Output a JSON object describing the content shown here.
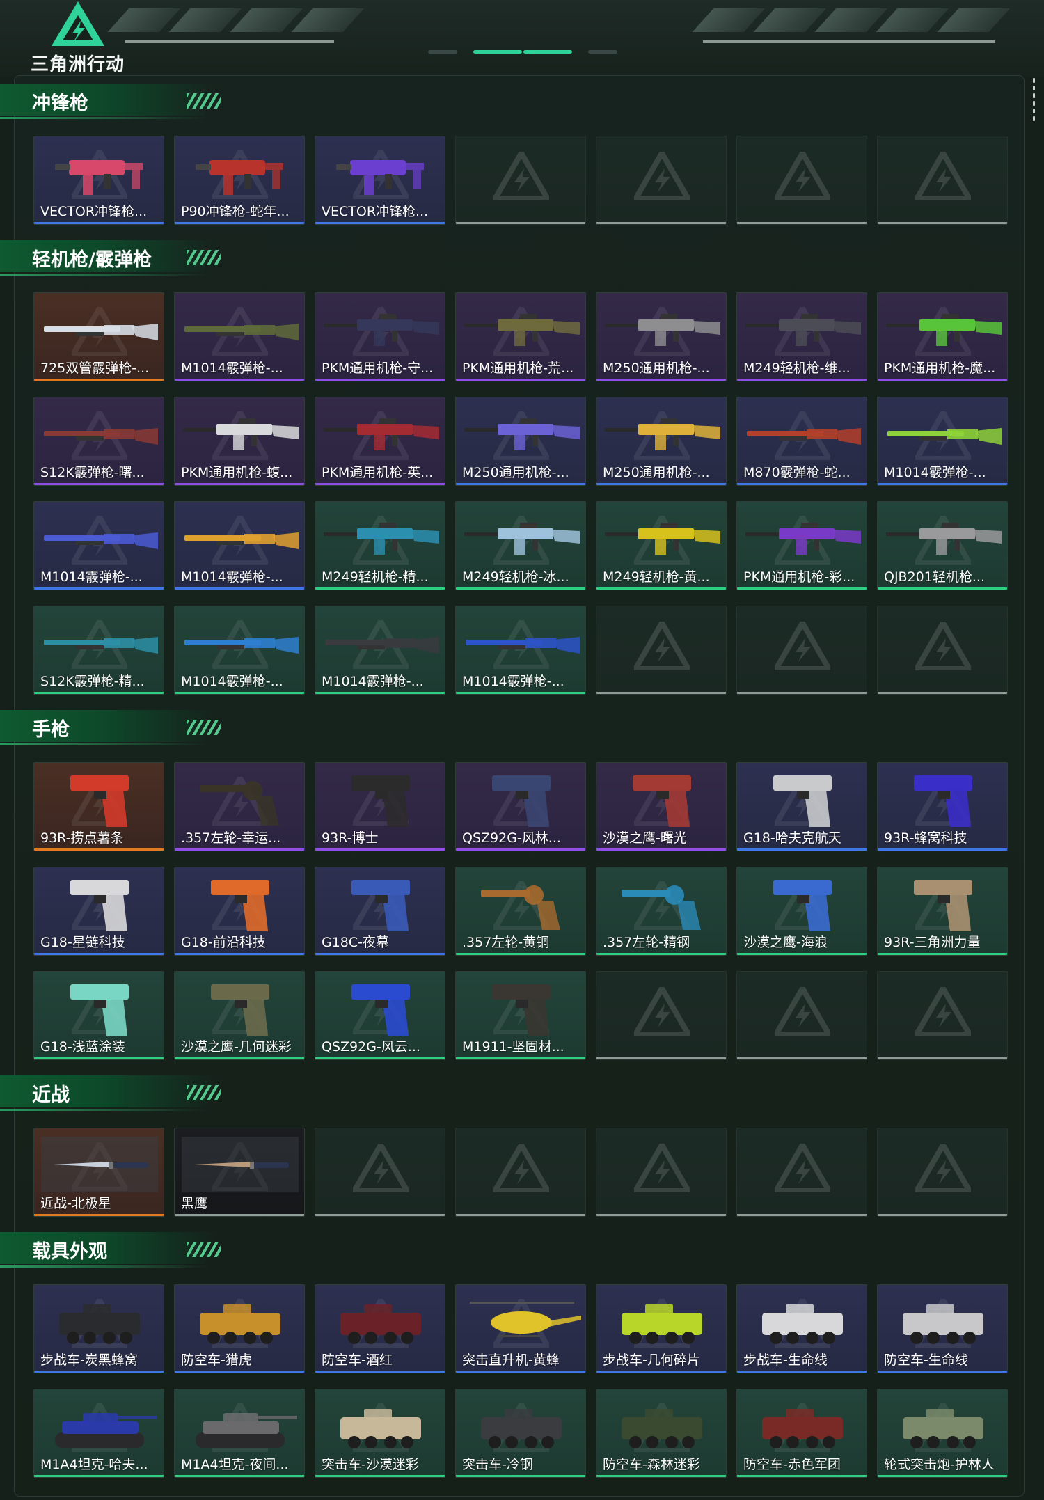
{
  "header": {
    "logo_text": "三角洲行动",
    "accent": "#2fd39a"
  },
  "sections": [
    {
      "title": "冲锋枪",
      "rows": [
        [
          {
            "label": "VECTOR冲锋枪...",
            "rarity": "blue",
            "icon": "smg-icon",
            "tint": "#d8486a"
          },
          {
            "label": "P90冲锋枪-蛇年...",
            "rarity": "blue",
            "icon": "smg-icon",
            "tint": "#b8332c"
          },
          {
            "label": "VECTOR冲锋枪...",
            "rarity": "blue",
            "icon": "smg-icon",
            "tint": "#6b3fd0"
          },
          null,
          null,
          null,
          null
        ]
      ]
    },
    {
      "title": "轻机枪/霰弹枪",
      "rows": [
        [
          {
            "label": "725双管霰弹枪-...",
            "rarity": "orange",
            "icon": "shotgun-icon",
            "tint": "#d8dde6"
          },
          {
            "label": "M1014霰弹枪-...",
            "rarity": "purple",
            "icon": "shotgun-icon",
            "tint": "#5e6a3a"
          },
          {
            "label": "PKM通用机枪-守...",
            "rarity": "purple",
            "icon": "machine-gun-icon",
            "tint": "#35385a"
          },
          {
            "label": "PKM通用机枪-荒...",
            "rarity": "purple",
            "icon": "machine-gun-icon",
            "tint": "#6f6a3e"
          },
          {
            "label": "M250通用机枪-...",
            "rarity": "purple",
            "icon": "machine-gun-icon",
            "tint": "#8e8e90"
          },
          {
            "label": "M249轻机枪-维...",
            "rarity": "purple",
            "icon": "machine-gun-icon",
            "tint": "#4b4c55"
          },
          {
            "label": "PKM通用机枪-魔...",
            "rarity": "purple",
            "icon": "machine-gun-icon",
            "tint": "#58c43a"
          }
        ],
        [
          {
            "label": "S12K霰弹枪-曙...",
            "rarity": "purple",
            "icon": "shotgun-icon",
            "tint": "#8a3a34"
          },
          {
            "label": "PKM通用机枪-蝮...",
            "rarity": "purple",
            "icon": "machine-gun-icon",
            "tint": "#d9dadc"
          },
          {
            "label": "PKM通用机枪-英...",
            "rarity": "purple",
            "icon": "machine-gun-icon",
            "tint": "#a52b32"
          },
          {
            "label": "M250通用机枪-...",
            "rarity": "blue",
            "icon": "machine-gun-icon",
            "tint": "#6b62d6"
          },
          {
            "label": "M250通用机枪-...",
            "rarity": "blue",
            "icon": "machine-gun-icon",
            "tint": "#e0b13a"
          },
          {
            "label": "M870霰弹枪-蛇...",
            "rarity": "blue",
            "icon": "shotgun-icon",
            "tint": "#b2402a"
          },
          {
            "label": "M1014霰弹枪-...",
            "rarity": "blue",
            "icon": "shotgun-icon",
            "tint": "#8ed13a"
          }
        ],
        [
          {
            "label": "M1014霰弹枪-...",
            "rarity": "blue",
            "icon": "shotgun-icon",
            "tint": "#4a5bd4"
          },
          {
            "label": "M1014霰弹枪-...",
            "rarity": "blue",
            "icon": "shotgun-icon",
            "tint": "#e0a030"
          },
          {
            "label": "M249轻机枪-精...",
            "rarity": "green",
            "icon": "machine-gun-icon",
            "tint": "#2b8fb0"
          },
          {
            "label": "M249轻机枪-冰...",
            "rarity": "green",
            "icon": "machine-gun-icon",
            "tint": "#9fc2dc"
          },
          {
            "label": "M249轻机枪-黄...",
            "rarity": "green",
            "icon": "machine-gun-icon",
            "tint": "#d7c21c"
          },
          {
            "label": "PKM通用机枪-彩...",
            "rarity": "green",
            "icon": "machine-gun-icon",
            "tint": "#7a3ac8"
          },
          {
            "label": "QJB201轻机枪...",
            "rarity": "green",
            "icon": "machine-gun-icon",
            "tint": "#9a9a9c"
          }
        ],
        [
          {
            "label": "S12K霰弹枪-精...",
            "rarity": "green",
            "icon": "shotgun-icon",
            "tint": "#2d8fa6"
          },
          {
            "label": "M1014霰弹枪-...",
            "rarity": "green",
            "icon": "shotgun-icon",
            "tint": "#2f7fd0"
          },
          {
            "label": "M1014霰弹枪-...",
            "rarity": "green",
            "icon": "shotgun-icon",
            "tint": "#3a3b3e"
          },
          {
            "label": "M1014霰弹枪-...",
            "rarity": "green",
            "icon": "shotgun-icon",
            "tint": "#2c54c8"
          },
          null,
          null,
          null
        ]
      ]
    },
    {
      "title": "手枪",
      "rows": [
        [
          {
            "label": "93R-捞点薯条",
            "rarity": "orange",
            "icon": "pistol-icon",
            "tint": "#d23a2a"
          },
          {
            "label": ".357左轮-幸运...",
            "rarity": "purple",
            "icon": "revolver-icon",
            "tint": "#3a3426"
          },
          {
            "label": "93R-博士",
            "rarity": "purple",
            "icon": "pistol-icon",
            "tint": "#2c2b2c"
          },
          {
            "label": "QSZ92G-风林...",
            "rarity": "purple",
            "icon": "pistol-icon",
            "tint": "#3a4672"
          },
          {
            "label": "沙漠之鹰-曙光",
            "rarity": "purple",
            "icon": "pistol-icon",
            "tint": "#a33a34"
          },
          {
            "label": "G18-哈夫克航天",
            "rarity": "blue",
            "icon": "pistol-icon",
            "tint": "#c8cacc"
          },
          {
            "label": "93R-蜂窝科技",
            "rarity": "blue",
            "icon": "pistol-icon",
            "tint": "#3a2ec8"
          }
        ],
        [
          {
            "label": "G18-星链科技",
            "rarity": "blue",
            "icon": "pistol-icon",
            "tint": "#d8d8da"
          },
          {
            "label": "G18-前沿科技",
            "rarity": "blue",
            "icon": "pistol-icon",
            "tint": "#e06a2a"
          },
          {
            "label": "G18C-夜幕",
            "rarity": "blue",
            "icon": "pistol-icon",
            "tint": "#3a5ab8"
          },
          {
            "label": ".357左轮-黄铜",
            "rarity": "green",
            "icon": "revolver-icon",
            "tint": "#a86a2e"
          },
          {
            "label": ".357左轮-精钢",
            "rarity": "green",
            "icon": "revolver-icon",
            "tint": "#2a8ab8"
          },
          {
            "label": "沙漠之鹰-海浪",
            "rarity": "green",
            "icon": "pistol-icon",
            "tint": "#3a6ad0"
          },
          {
            "label": "93R-三角洲力量",
            "rarity": "green",
            "icon": "pistol-icon",
            "tint": "#a89070"
          }
        ],
        [
          {
            "label": "G18-浅蓝涂装",
            "rarity": "green",
            "icon": "pistol-icon",
            "tint": "#7ad6c4"
          },
          {
            "label": "沙漠之鹰-几何迷彩",
            "rarity": "green",
            "icon": "pistol-icon",
            "tint": "#6a6a4a"
          },
          {
            "label": "QSZ92G-风云...",
            "rarity": "green",
            "icon": "pistol-icon",
            "tint": "#2a4ad0"
          },
          {
            "label": "M1911-坚固材...",
            "rarity": "green",
            "icon": "pistol-icon",
            "tint": "#3a3632"
          },
          null,
          null,
          null
        ]
      ]
    },
    {
      "title": "近战",
      "rows": [
        [
          {
            "label": "近战-北极星",
            "rarity": "orange",
            "icon": "knife-icon",
            "tint": "#c8d0dc"
          },
          {
            "label": "黑鹰",
            "rarity": "dark",
            "icon": "knife-icon",
            "tint": "#b89a7a"
          },
          null,
          null,
          null,
          null,
          null
        ]
      ]
    },
    {
      "title": "载具外观",
      "rows": [
        [
          {
            "label": "步战车-炭黑蜂窝",
            "rarity": "blue",
            "icon": "vehicle-icon",
            "tint": "#2a2b2e"
          },
          {
            "label": "防空车-猎虎",
            "rarity": "blue",
            "icon": "vehicle-icon",
            "tint": "#c8902a"
          },
          {
            "label": "防空车-酒红",
            "rarity": "blue",
            "icon": "vehicle-icon",
            "tint": "#6a2228"
          },
          {
            "label": "突击直升机-黄蜂",
            "rarity": "blue",
            "icon": "helicopter-icon",
            "tint": "#e0c22a"
          },
          {
            "label": "步战车-几何碎片",
            "rarity": "blue",
            "icon": "vehicle-icon",
            "tint": "#b8d62a"
          },
          {
            "label": "步战车-生命线",
            "rarity": "blue",
            "icon": "vehicle-icon",
            "tint": "#d8d8da"
          },
          {
            "label": "防空车-生命线",
            "rarity": "blue",
            "icon": "vehicle-icon",
            "tint": "#c8c8ca"
          }
        ],
        [
          {
            "label": "M1A4坦克-哈夫...",
            "rarity": "green",
            "icon": "tank-icon",
            "tint": "#2a3aa8"
          },
          {
            "label": "M1A4坦克-夜间...",
            "rarity": "green",
            "icon": "tank-icon",
            "tint": "#6a6a6c"
          },
          {
            "label": "突击车-沙漠迷彩",
            "rarity": "green",
            "icon": "vehicle-icon",
            "tint": "#c8b89a"
          },
          {
            "label": "突击车-冷钢",
            "rarity": "green",
            "icon": "vehicle-icon",
            "tint": "#3a3c40"
          },
          {
            "label": "防空车-森林迷彩",
            "rarity": "green",
            "icon": "vehicle-icon",
            "tint": "#3a4a30"
          },
          {
            "label": "防空车-赤色军团",
            "rarity": "green",
            "icon": "vehicle-icon",
            "tint": "#7a2a26"
          },
          {
            "label": "轮式突击炮-护林人",
            "rarity": "green",
            "icon": "vehicle-icon",
            "tint": "#7a8a6a"
          }
        ]
      ]
    }
  ]
}
